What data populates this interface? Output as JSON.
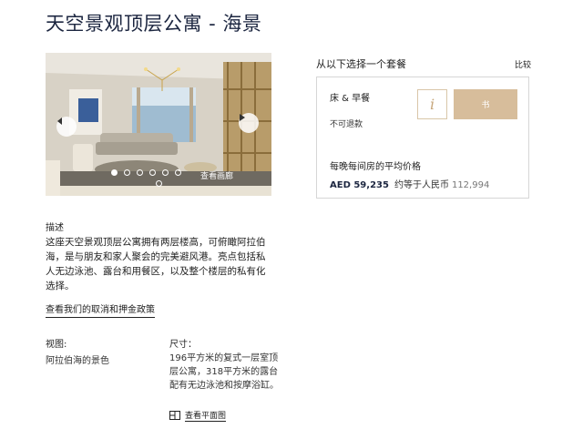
{
  "header": {
    "title": "天空景观顶层公寓 - 海景"
  },
  "gallery": {
    "view_gallery": "查看画廊",
    "dots_row1": 6,
    "dots_row2": 1
  },
  "booking": {
    "choose_label": "从以下选择一个套餐",
    "compare_label": "比较",
    "package_name": "床 & 早餐",
    "refund_policy": "不可退款",
    "info_label": "i",
    "book_label": "书",
    "avg_price_label": "每晚每间房的平均价格",
    "price": "AED 59,235",
    "approx_label": "约等于人民币",
    "rmb_value": "112,994"
  },
  "description": {
    "heading": "描述",
    "body": "这座天空景观顶层公寓拥有两层楼高，可俯瞰阿拉伯海，是与朋友和家人聚会的完美避风港。亮点包括私人无边泳池、露台和用餐区，以及整个楼层的私有化选择。",
    "policy_link": "查看我们的取消和押金政策"
  },
  "details": {
    "view_heading": "视图:",
    "view_value": "阿拉伯海的景色",
    "size_heading": "尺寸：",
    "size_text": "196平方米的复式一层室顶层公寓，318平方米的露台配有无边泳池和按摩浴缸。",
    "floorplan_link": "查看平面图"
  },
  "colors": {
    "title": "#1c2640",
    "gold": "#d7bd9b",
    "border": "#d6d6d6"
  }
}
